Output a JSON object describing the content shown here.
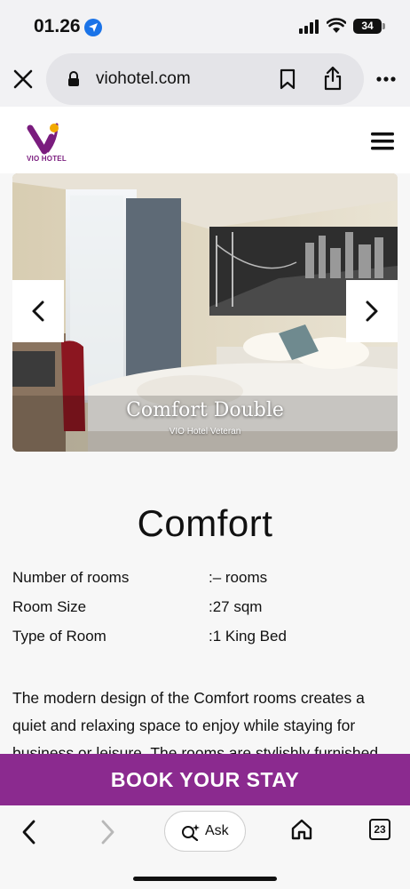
{
  "status_bar": {
    "time": "01.26",
    "battery": "34"
  },
  "browser": {
    "url": "viohotel.com",
    "tab_count": "23",
    "ask_label": "Ask"
  },
  "site": {
    "logo_text": "VIO HOTEL"
  },
  "carousel": {
    "slide_title": "Comfort Double",
    "slide_subtitle": "VIO Hotel Veteran"
  },
  "room": {
    "title": "Comfort",
    "specs": [
      {
        "label": "Number of rooms",
        "value": ":– rooms"
      },
      {
        "label": "Room Size",
        "value": ":27 sqm"
      },
      {
        "label": "Type of Room",
        "value": ":1 King Bed"
      }
    ],
    "description": "The modern design of the Comfort rooms creates a quiet and relaxing space to enjoy while staying for business or leisure. The rooms are stylishly furnished"
  },
  "cta": {
    "book_label": "BOOK YOUR STAY"
  },
  "colors": {
    "brand_purple": "#8b2a8f",
    "logo_gold": "#f2a900"
  }
}
